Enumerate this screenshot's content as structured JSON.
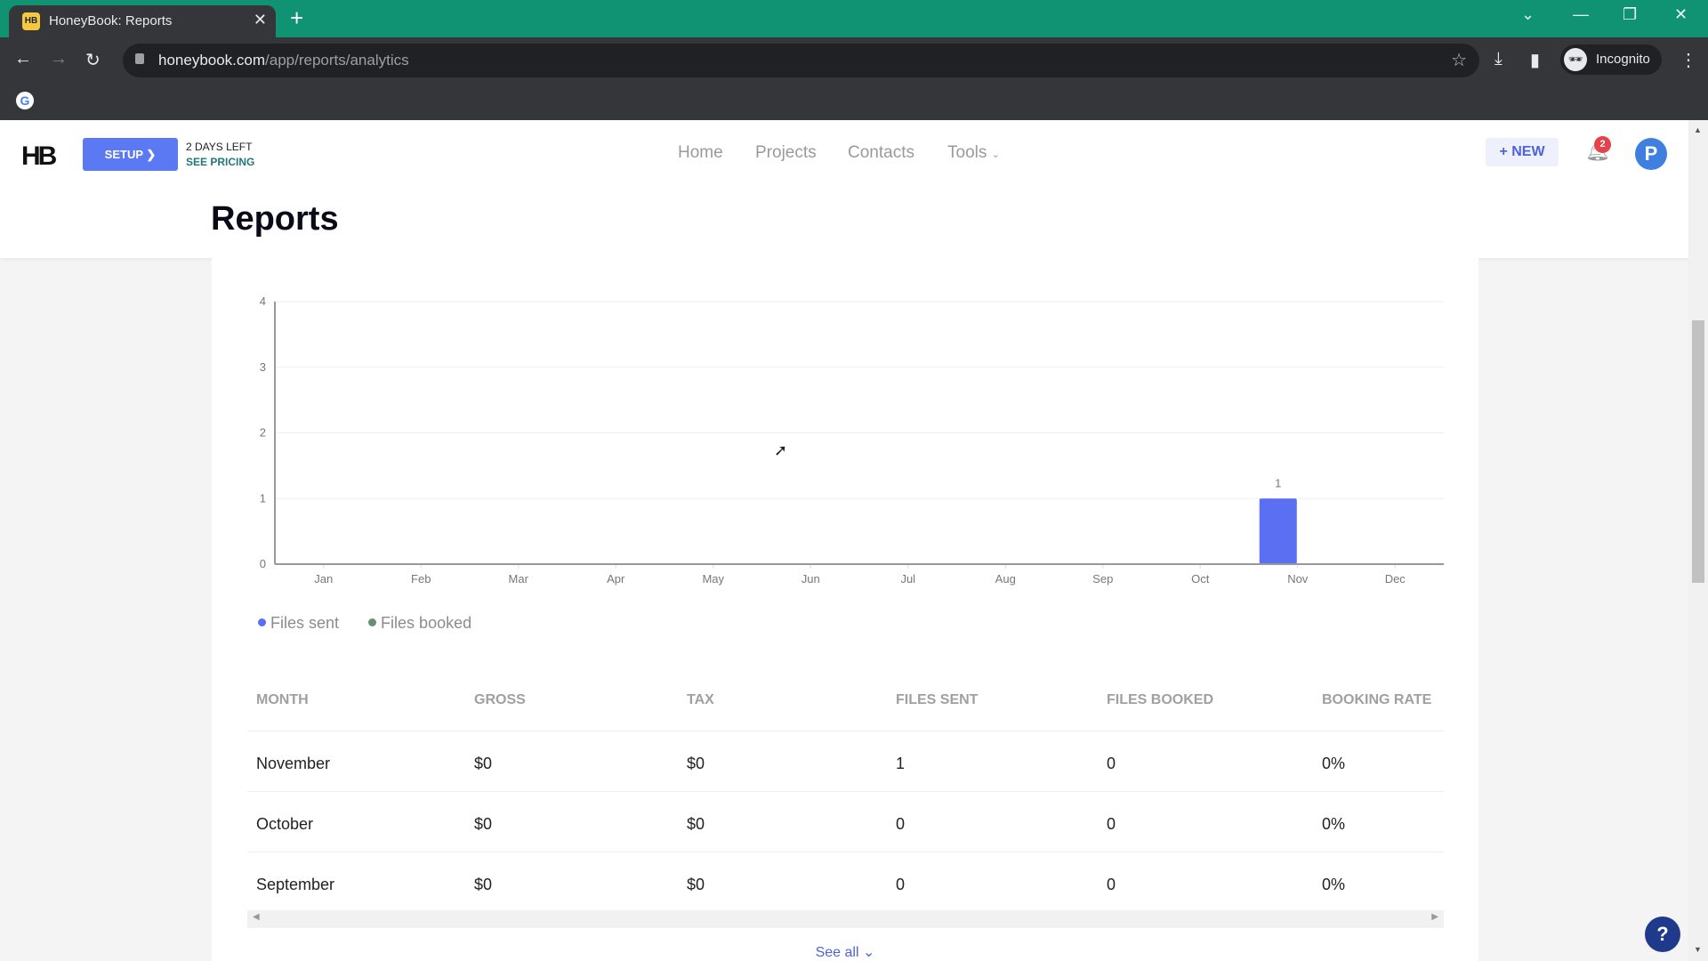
{
  "browser": {
    "tab_title": "HoneyBook: Reports",
    "favicon_text": "HB",
    "url_domain": "honeybook.com",
    "url_path": "/app/reports/analytics",
    "profile_label": "Incognito"
  },
  "header": {
    "logo": "HB",
    "setup_label": "SETUP",
    "trial_days": "2 DAYS LEFT",
    "pricing_link": "SEE PRICING",
    "nav": [
      {
        "label": "Home"
      },
      {
        "label": "Projects"
      },
      {
        "label": "Contacts"
      },
      {
        "label": "Tools"
      }
    ],
    "new_button": "NEW",
    "notification_count": "2",
    "avatar_initial": "P",
    "page_title": "Reports"
  },
  "colors": {
    "files_sent": "#5b6ff2",
    "files_booked": "#6b8f72",
    "accent": "#5b79f2"
  },
  "chart_data": {
    "type": "bar",
    "title": "",
    "xlabel": "",
    "ylabel": "",
    "categories": [
      "Jan",
      "Feb",
      "Mar",
      "Apr",
      "May",
      "Jun",
      "Jul",
      "Aug",
      "Sep",
      "Oct",
      "Nov",
      "Dec"
    ],
    "series": [
      {
        "name": "Files sent",
        "values": [
          0,
          0,
          0,
          0,
          0,
          0,
          0,
          0,
          0,
          0,
          1,
          0
        ]
      },
      {
        "name": "Files booked",
        "values": [
          0,
          0,
          0,
          0,
          0,
          0,
          0,
          0,
          0,
          0,
          0,
          0
        ]
      }
    ],
    "ylim": [
      0,
      4
    ],
    "yticks": [
      "0",
      "1",
      "2",
      "3",
      "4"
    ],
    "data_labels": [
      {
        "category": "Nov",
        "series": "Files sent",
        "label": "1"
      }
    ],
    "grid": true,
    "legend": "bottom-left"
  },
  "legend": [
    {
      "label": "Files sent"
    },
    {
      "label": "Files booked"
    }
  ],
  "table": {
    "columns": [
      "MONTH",
      "GROSS",
      "TAX",
      "FILES SENT",
      "FILES BOOKED",
      "BOOKING RATE"
    ],
    "rows": [
      [
        "November",
        "$0",
        "$0",
        "1",
        "0",
        "0%"
      ],
      [
        "October",
        "$0",
        "$0",
        "0",
        "0",
        "0%"
      ],
      [
        "September",
        "$0",
        "$0",
        "0",
        "0",
        "0%"
      ]
    ],
    "see_all": "See all"
  },
  "help_label": "?"
}
